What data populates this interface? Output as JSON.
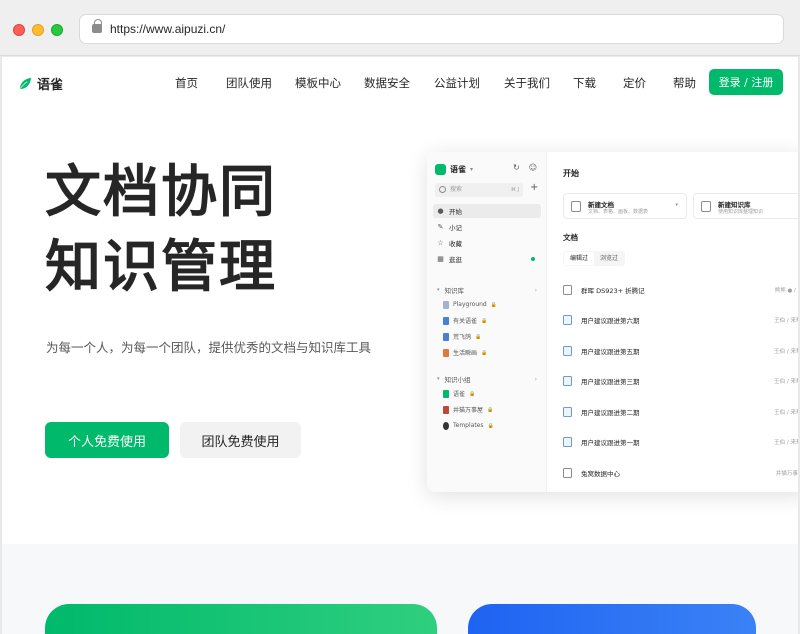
{
  "browser": {
    "url": "https://www.aipuzi.cn/"
  },
  "nav": {
    "brand": "语雀",
    "items": [
      "首页",
      "团队使用",
      "模板中心",
      "数据安全",
      "公益计划",
      "关于我们",
      "下载",
      "定价",
      "帮助"
    ],
    "login": "登录 / 注册"
  },
  "hero": {
    "title_line1": "文档协同",
    "title_line2": "知识管理",
    "subtitle": "为每一个人，为每一个团队，提供优秀的文档与知识库工具",
    "primary_button": "个人免费使用",
    "secondary_button": "团队免费使用"
  },
  "app": {
    "sidebar": {
      "brand": "语雀",
      "search_placeholder": "搜索",
      "search_shortcut": "⌘ J",
      "menu": [
        "开始",
        "小记",
        "收藏",
        "逛逛"
      ],
      "section_library": "知识库",
      "libraries": [
        "Playground",
        "有关语雀",
        "荒飞鸽",
        "生活瞬画"
      ],
      "section_groups": "知识小组",
      "groups": [
        "语雀",
        "井猫万事屋",
        "Templates"
      ]
    },
    "main": {
      "title": "开始",
      "card1_title": "新建文档",
      "card1_sub": "文档、表格、画板、数据表",
      "card2_title": "新建知识库",
      "card2_sub": "使用知识库整理知识",
      "docs_title": "文档",
      "tab_edited": "编辑过",
      "tab_viewed": "浏览过",
      "rows": [
        {
          "name": "群晖 DS923+ 折腾记",
          "meta": "熊熊 ● / 🐱 /"
        },
        {
          "name": "用户建议跟进第六期",
          "meta": "王伯 / 来帮语"
        },
        {
          "name": "用户建议跟进第五期",
          "meta": "王伯 / 来帮语"
        },
        {
          "name": "用户建议跟进第三期",
          "meta": "王伯 / 来帮语"
        },
        {
          "name": "用户建议跟进第二期",
          "meta": "王伯 / 来帮语"
        },
        {
          "name": "用户建议跟进第一期",
          "meta": "王伯 / 来帮语"
        },
        {
          "name": "兔窝数据中心",
          "meta": "井猫万事屋 /"
        }
      ]
    }
  },
  "colors": {
    "brand_green": "#00b96b",
    "accent_blue": "#1e63f2"
  }
}
